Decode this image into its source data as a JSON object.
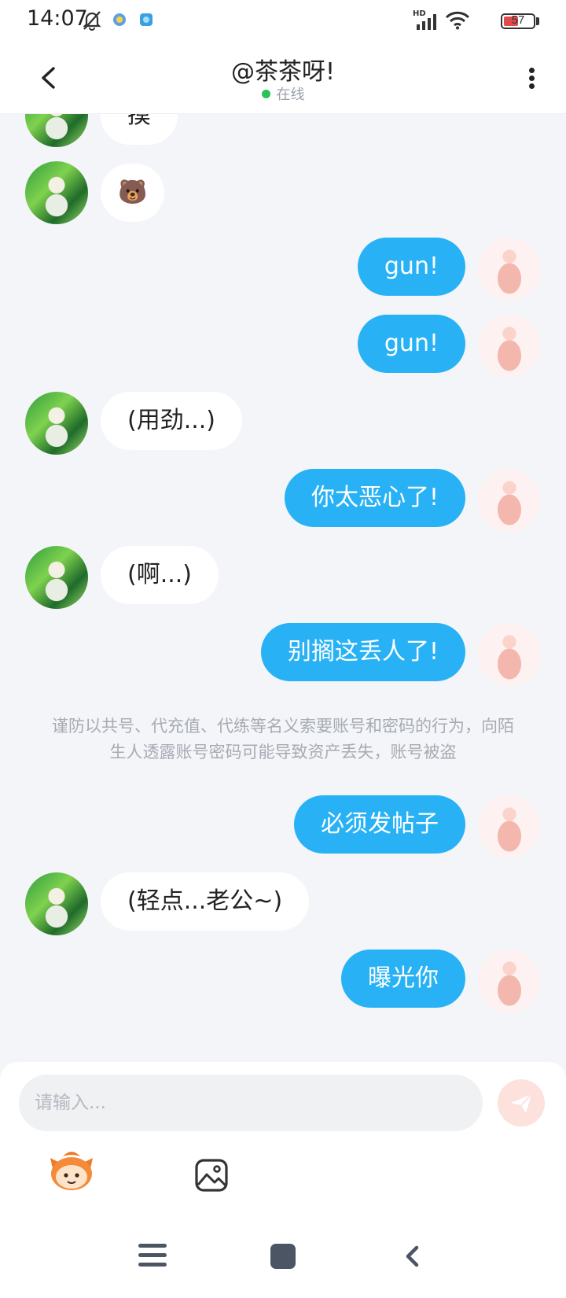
{
  "status_bar": {
    "time": "14:07",
    "network": "HD",
    "battery": "57"
  },
  "header": {
    "title": "@茶茶呀!",
    "status": "在线"
  },
  "messages": [
    {
      "side": "in",
      "text": "摸"
    },
    {
      "side": "in",
      "text": "🐻"
    },
    {
      "side": "out",
      "text": "gun!"
    },
    {
      "side": "out",
      "text": "gun!"
    },
    {
      "side": "in",
      "text": "(用劲...)"
    },
    {
      "side": "out",
      "text": "你太恶心了!"
    },
    {
      "side": "in",
      "text": "(啊...)"
    },
    {
      "side": "out",
      "text": "别搁这丢人了!"
    },
    {
      "side": "notice",
      "text": "谨防以共号、代充值、代练等名义索要账号和密码的行为，向陌生人透露账号密码可能导致资产丢失，账号被盗"
    },
    {
      "side": "out",
      "text": "必须发帖子"
    },
    {
      "side": "in",
      "text": "(轻点...老公~)"
    },
    {
      "side": "out",
      "text": "曝光你"
    }
  ],
  "input": {
    "placeholder": "请输入...",
    "value": ""
  },
  "icons": {
    "back": "chevron-left-icon",
    "more": "more-vertical-icon",
    "send": "send-icon",
    "emoji": "emoji-mascot-icon",
    "image": "image-icon",
    "nav_menu": "menu-icon",
    "nav_home": "home-icon",
    "nav_back": "back-icon"
  },
  "colors": {
    "outgoing_bubble": "#28b2f5",
    "incoming_bubble": "#ffffff",
    "background": "#f4f5f9",
    "online_dot": "#27c25a",
    "send_button": "#fde1dc"
  }
}
